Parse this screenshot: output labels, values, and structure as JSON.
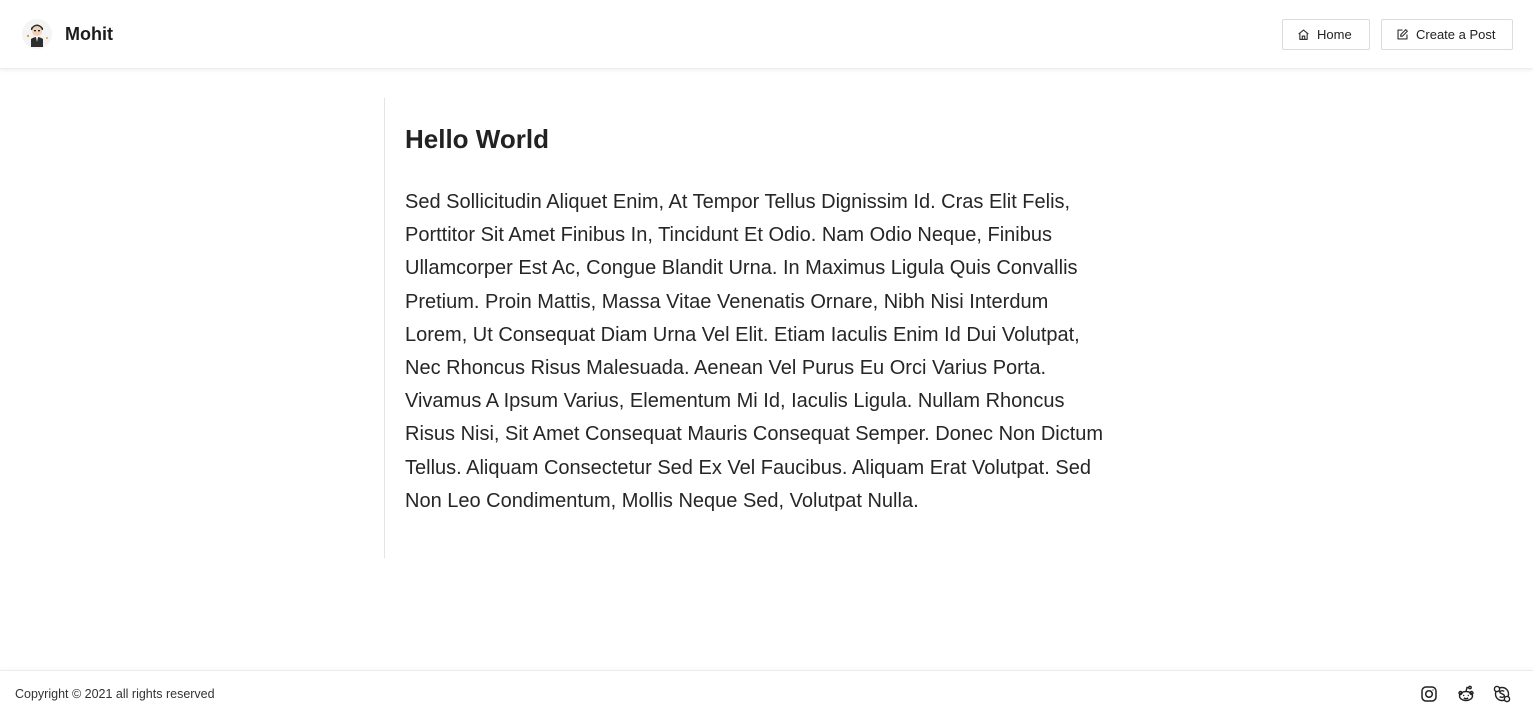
{
  "header": {
    "brand_name": "Mohit",
    "avatar_icon": "cartoon-avatar-icon",
    "nav": [
      {
        "label": "Home",
        "icon": "home-icon"
      },
      {
        "label": "Create a Post",
        "icon": "edit-icon"
      }
    ]
  },
  "post": {
    "title": "Hello World",
    "body": "Sed Sollicitudin Aliquet Enim, At Tempor Tellus Dignissim Id. Cras Elit Felis, Porttitor Sit Amet Finibus In, Tincidunt Et Odio. Nam Odio Neque, Finibus Ullamcorper Est Ac, Congue Blandit Urna. In Maximus Ligula Quis Convallis Pretium. Proin Mattis, Massa Vitae Venenatis Ornare, Nibh Nisi Interdum Lorem, Ut Consequat Diam Urna Vel Elit. Etiam Iaculis Enim Id Dui Volutpat, Nec Rhoncus Risus Malesuada. Aenean Vel Purus Eu Orci Varius Porta. Vivamus A Ipsum Varius, Elementum Mi Id, Iaculis Ligula. Nullam Rhoncus Risus Nisi, Sit Amet Consequat Mauris Consequat Semper. Donec Non Dictum Tellus. Aliquam Consectetur Sed Ex Vel Faucibus. Aliquam Erat Volutpat. Sed Non Leo Condimentum, Mollis Neque Sed, Volutpat Nulla."
  },
  "footer": {
    "copyright": "Copyright © 2021 all rights reserved",
    "social_icons": [
      "instagram-icon",
      "reddit-icon",
      "skype-icon"
    ]
  },
  "colors": {
    "background": "#ffffff",
    "text": "#222222",
    "border": "#dcdcdc"
  }
}
